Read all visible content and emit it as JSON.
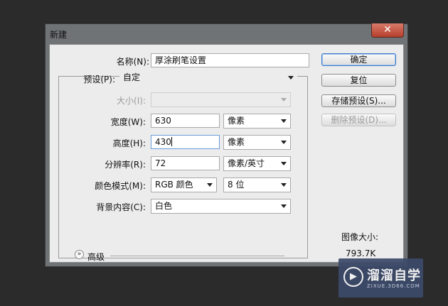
{
  "window": {
    "title": "新建",
    "close_glyph": "✕"
  },
  "form": {
    "name": {
      "label": "名称(N):",
      "value": "厚涂刷笔设置"
    },
    "preset": {
      "label": "预设(P):",
      "value": "自定"
    },
    "size": {
      "label": "大小(I):",
      "value": ""
    },
    "width": {
      "label": "宽度(W):",
      "value": "630",
      "unit": "像素"
    },
    "height": {
      "label": "高度(H):",
      "value": "430",
      "unit": "像素"
    },
    "resolution": {
      "label": "分辨率(R):",
      "value": "72",
      "unit": "像素/英寸"
    },
    "color_mode": {
      "label": "颜色模式(M):",
      "value": "RGB 颜色",
      "depth": "8 位"
    },
    "background": {
      "label": "背景内容(C):",
      "value": "白色"
    },
    "advanced": {
      "label": "高级",
      "icon": "expand-icon"
    }
  },
  "buttons": {
    "ok": "确定",
    "reset": "复位",
    "save_preset": "存储预设(S)...",
    "delete_preset": "删除预设(D)..."
  },
  "image_size": {
    "label": "图像大小:",
    "value": "793.7K"
  },
  "watermark": {
    "brand": "溜溜自学",
    "url": "ZIXUE.3D66.COM"
  },
  "colors": {
    "dialog_bg": "#ececec",
    "focus": "#6a9bd8",
    "close": "#c4523f",
    "watermark": "#3c4a6a"
  }
}
